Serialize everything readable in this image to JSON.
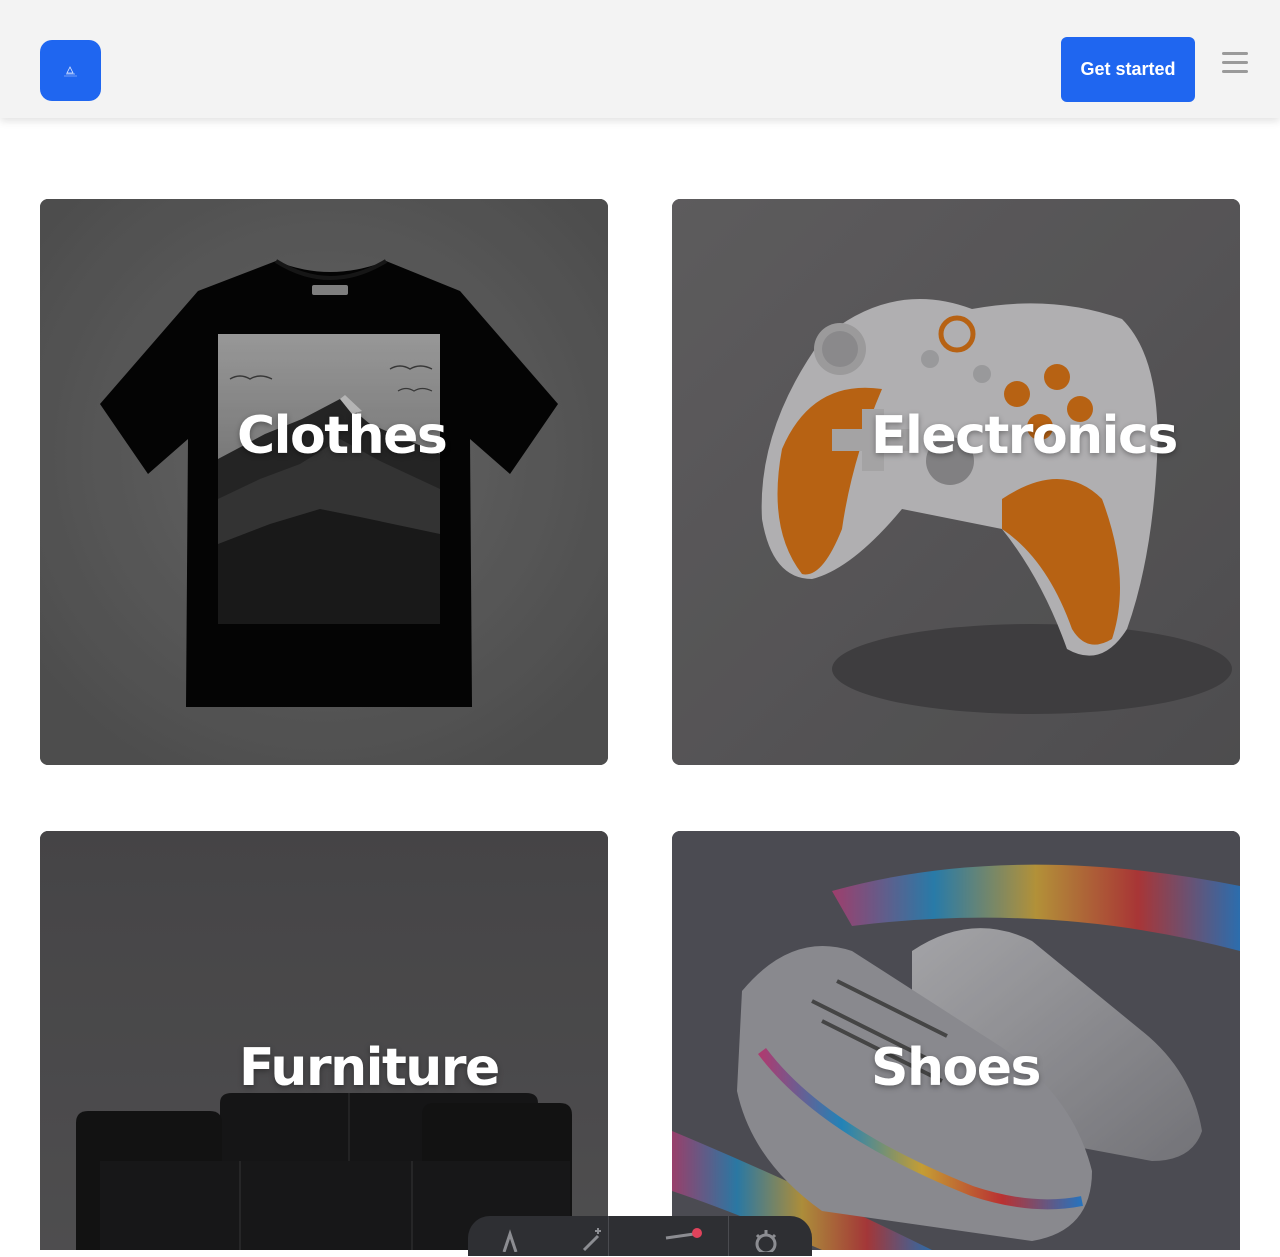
{
  "header": {
    "logo_alt": "logo",
    "cta_label": "Get started",
    "menu_icon": "hamburger-menu-icon"
  },
  "categories": [
    {
      "id": "clothes",
      "label": "Clothes"
    },
    {
      "id": "electronics",
      "label": "Electronics"
    },
    {
      "id": "furniture",
      "label": "Furniture"
    },
    {
      "id": "shoes",
      "label": "Shoes"
    }
  ],
  "dock": {
    "tools": [
      "text-tool-icon",
      "magic-wand-icon",
      "pen-tool-icon",
      "settings-gear-icon"
    ]
  },
  "colors": {
    "accent": "#1f66f0",
    "header_bg": "#f3f3f3"
  }
}
